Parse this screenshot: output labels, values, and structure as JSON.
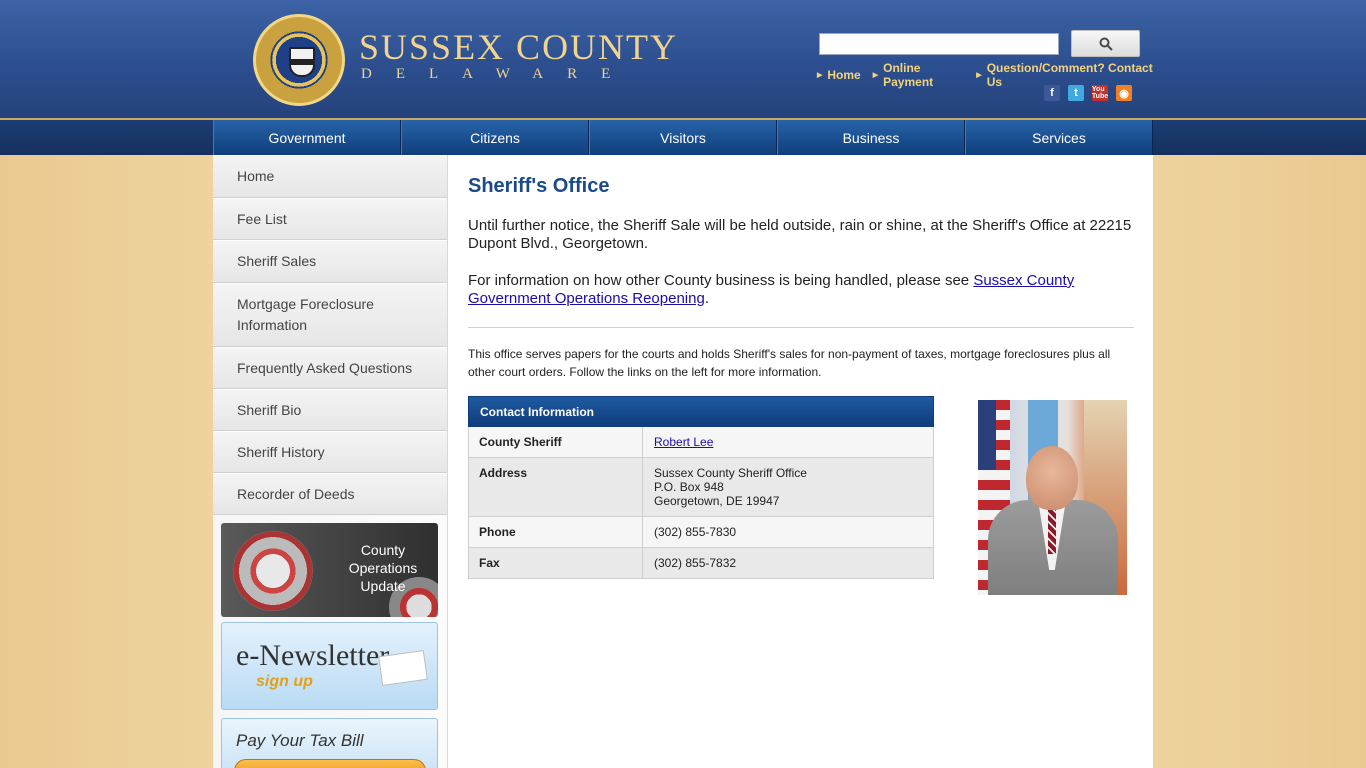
{
  "header": {
    "title": "SUSSEX COUNTY",
    "subtitle": "DELAWARE",
    "search": {
      "placeholder": "",
      "button_icon": "search-icon"
    },
    "links": [
      "Home",
      "Online Payment",
      "Question/Comment? Contact Us"
    ],
    "social": [
      "facebook-icon",
      "twitter-icon",
      "youtube-icon",
      "rss-icon"
    ],
    "youtube_label": "You Tube"
  },
  "nav": [
    "Government",
    "Citizens",
    "Visitors",
    "Business",
    "Services"
  ],
  "sidebar": {
    "items": [
      "Home",
      "Fee List",
      "Sheriff Sales",
      "Mortgage Foreclosure Information",
      "Frequently Asked Questions",
      "Sheriff Bio",
      "Sheriff History",
      "Recorder of Deeds"
    ],
    "promos": {
      "covid": "County Operations Update",
      "newsletter_title": "e-Newsletter",
      "newsletter_sub": "sign up",
      "tax": "Pay Your Tax Bill"
    }
  },
  "main": {
    "title": "Sheriff's Office",
    "notice": "Until further notice, the Sheriff Sale will be held outside, rain or shine, at the Sheriff's Office at 22215 Dupont Blvd., Georgetown.",
    "info_prefix": "For information on how other County business is being handled, please see ",
    "info_link": "Sussex County Government Operations Reopening",
    "info_suffix": ".",
    "description": "This office serves papers for the courts and holds Sheriff's sales for non-payment of taxes, mortgage foreclosures plus all other court orders. Follow the links on the left for more information."
  },
  "contact": {
    "heading": "Contact Information",
    "rows": [
      {
        "label": "County Sheriff",
        "value": "Robert Lee"
      },
      {
        "label": "Address",
        "lines": [
          "Sussex County Sheriff Office",
          "P.O. Box 948",
          "Georgetown, DE 19947"
        ]
      },
      {
        "label": "Phone",
        "value": "(302) 855-7830"
      },
      {
        "label": "Fax",
        "value": "(302) 855-7832"
      }
    ]
  }
}
